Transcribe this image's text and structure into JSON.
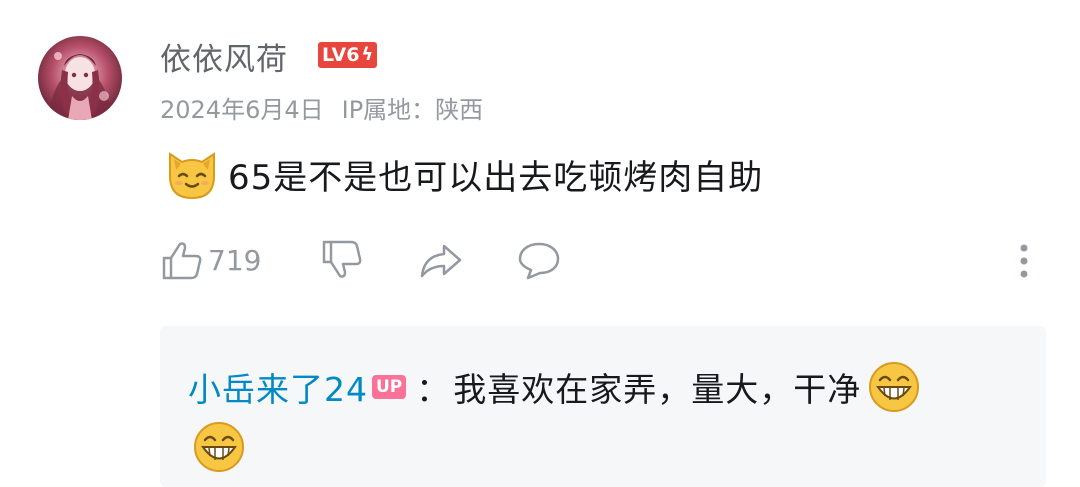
{
  "comment": {
    "username": "依依风荷",
    "level_badge": "LV6",
    "date": "2024年6月4日",
    "ip_location": "IP属地：陕西",
    "text": "65是不是也可以出去吃顿烤肉自助",
    "emoji": "cat-face-emoji",
    "likes": "719"
  },
  "reply": {
    "user": "小岳来了24",
    "badge": "UP",
    "separator": "：",
    "text": "我喜欢在家弄，量大，干净",
    "emoji": "grinning-face-emoji"
  },
  "colors": {
    "username": "#61666d",
    "meta": "#9499a0",
    "level_badge": "#e8453c",
    "reply_user": "#008ac5",
    "up_badge": "#fb7299",
    "reply_bg": "#f6f7f8"
  }
}
